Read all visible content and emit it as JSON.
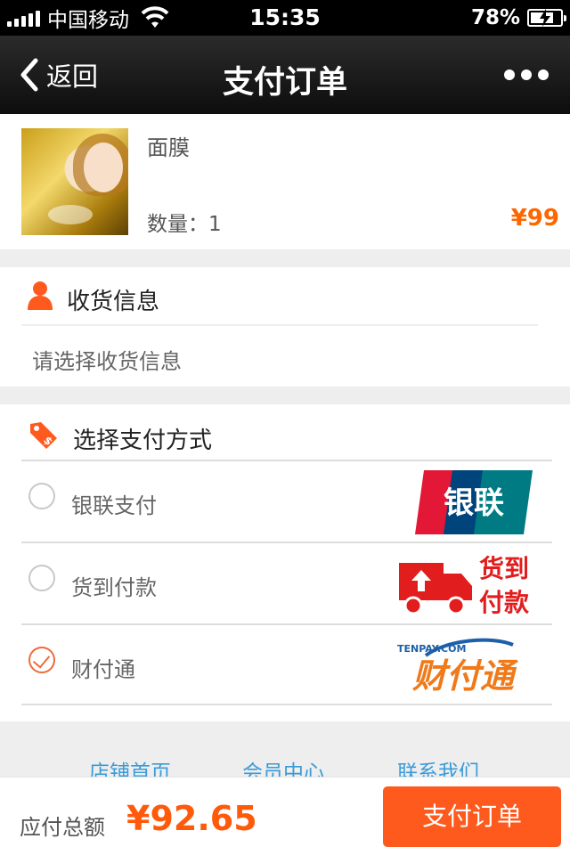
{
  "status_bar": {
    "carrier": "中国移动",
    "time": "15:35",
    "battery": "78%",
    "battery_level": 0.78
  },
  "nav": {
    "back_label": "返回",
    "title": "支付订单"
  },
  "product": {
    "name": "面膜",
    "quantity_label": "数量：",
    "quantity": "1",
    "price": "¥99"
  },
  "shipping": {
    "title": "收货信息",
    "placeholder": "请选择收货信息"
  },
  "payment": {
    "title": "选择支付方式",
    "methods": [
      {
        "label": "银联支付",
        "selected": false,
        "logo_text": "银联"
      },
      {
        "label": "货到付款",
        "selected": false,
        "logo_text_1": "货到",
        "logo_text_2": "付款"
      },
      {
        "label": "财付通",
        "selected": true,
        "logo_text": "财付通",
        "logo_small": "TENPAY.COM"
      }
    ]
  },
  "footer_links": [
    "店铺首页",
    "会员中心",
    "联系我们"
  ],
  "bottom_bar": {
    "total_label": "应付总额",
    "total_value": "¥92.65",
    "pay_button": "支付订单"
  },
  "colors": {
    "accent": "#ff5a1e",
    "price": "#ff6600",
    "link": "#3a9bd8"
  }
}
